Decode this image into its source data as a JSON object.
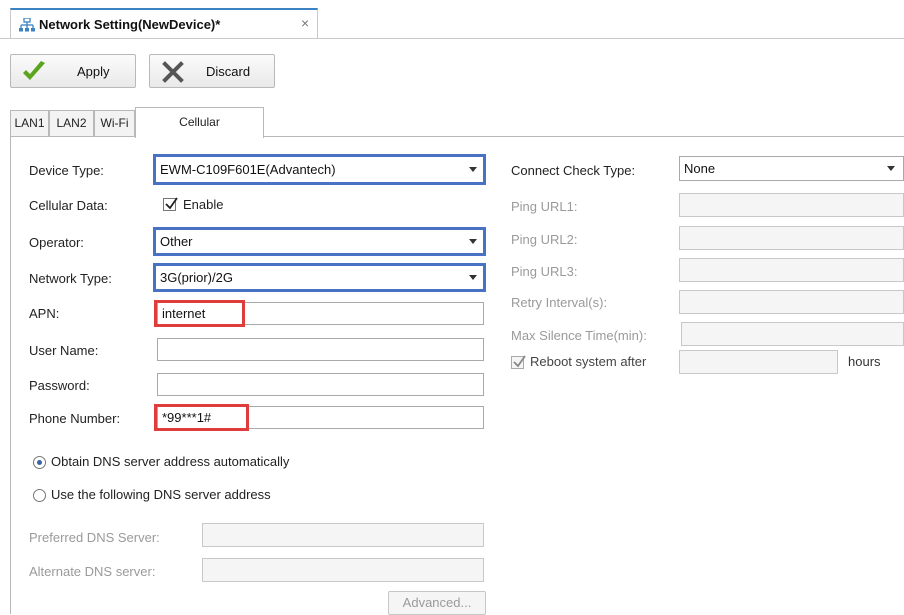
{
  "document_tab": {
    "title": "Network Setting(NewDevice)*",
    "close": "×"
  },
  "toolbar": {
    "apply_label": "Apply",
    "discard_label": "Discard"
  },
  "tabs": [
    {
      "label": "LAN1"
    },
    {
      "label": "LAN2"
    },
    {
      "label": "Wi-Fi"
    },
    {
      "label": "Cellular"
    }
  ],
  "active_tab": "Cellular",
  "cellular": {
    "device_type": {
      "label": "Device Type:",
      "value": "EWM-C109F601E(Advantech)"
    },
    "cellular_data": {
      "label": "Cellular Data:",
      "checkbox_label": "Enable",
      "checked": true
    },
    "operator": {
      "label": "Operator:",
      "value": "Other"
    },
    "network_type": {
      "label": "Network Type:",
      "value": "3G(prior)/2G"
    },
    "apn": {
      "label": "APN:",
      "value": "internet"
    },
    "user_name": {
      "label": "User Name:",
      "value": ""
    },
    "password": {
      "label": "Password:",
      "value": ""
    },
    "phone_number": {
      "label": "Phone Number:",
      "value": "*99***1#"
    }
  },
  "dns": {
    "auto_option": "Obtain DNS server address automatically",
    "manual_option": "Use the following DNS server address",
    "selected": "auto",
    "preferred_label": "Preferred DNS Server:",
    "preferred_value": "",
    "alternate_label": "Alternate DNS server:",
    "alternate_value": "",
    "advanced_label": "Advanced..."
  },
  "connect_check": {
    "type_label": "Connect Check Type:",
    "type_value": "None",
    "ping_url1_label": "Ping URL1:",
    "ping_url2_label": "Ping URL2:",
    "ping_url3_label": "Ping URL3:",
    "retry_label": "Retry Interval(s):",
    "max_silence_label": "Max Silence Time(min):",
    "reboot_label": "Reboot system after",
    "reboot_checked": true,
    "hours_label": "hours"
  },
  "colors": {
    "highlight_blue": "#4a72c4",
    "highlight_red": "#e03c3c",
    "apply_check_green": "#5aa51d",
    "tab_accent": "#3b82c4"
  },
  "icons": {
    "tab_icon": "network-icon",
    "apply_icon": "green-check-icon",
    "discard_icon": "x-icon"
  }
}
